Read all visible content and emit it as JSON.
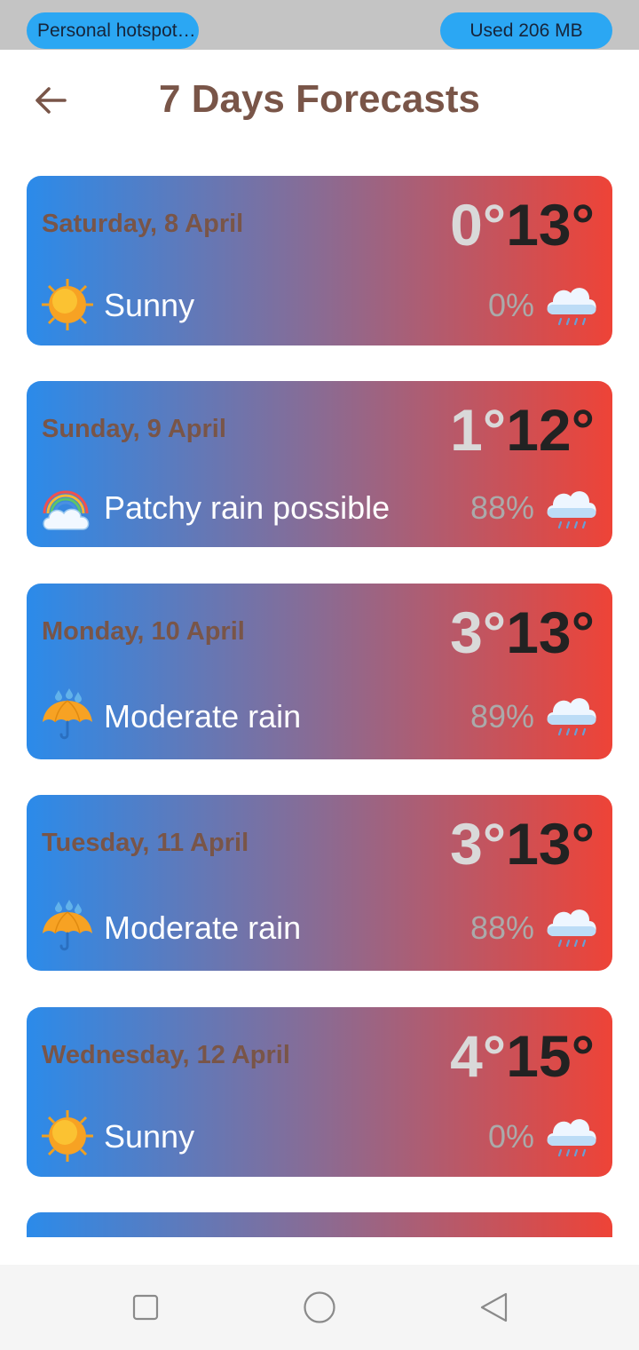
{
  "status": {
    "hotspot_label": "Personal hotspot…",
    "data_usage": "Used  206 MB"
  },
  "header": {
    "back_icon": "arrow-left-icon",
    "title": "7 Days Forecasts"
  },
  "colors": {
    "title": "#795548",
    "card_gradient": [
      "#2b8bea",
      "#8a6b93",
      "#ee4337"
    ],
    "status_pill": "#2ba7f3"
  },
  "forecasts": [
    {
      "date": "Saturday, 8 April",
      "min": "0°",
      "max": "13°",
      "condition": "Sunny",
      "condition_icon": "sun-icon",
      "rain_chance": "0%",
      "rain_icon": "rain-cloud-icon"
    },
    {
      "date": "Sunday, 9 April",
      "min": "1°",
      "max": "12°",
      "condition": "Patchy rain possible",
      "condition_icon": "rainbow-cloud-icon",
      "rain_chance": "88%",
      "rain_icon": "rain-cloud-icon"
    },
    {
      "date": "Monday, 10 April",
      "min": "3°",
      "max": "13°",
      "condition": "Moderate rain",
      "condition_icon": "umbrella-rain-icon",
      "rain_chance": "89%",
      "rain_icon": "rain-cloud-icon"
    },
    {
      "date": "Tuesday, 11 April",
      "min": "3°",
      "max": "13°",
      "condition": "Moderate rain",
      "condition_icon": "umbrella-rain-icon",
      "rain_chance": "88%",
      "rain_icon": "rain-cloud-icon"
    },
    {
      "date": "Wednesday, 12 April",
      "min": "4°",
      "max": "15°",
      "condition": "Sunny",
      "condition_icon": "sun-icon",
      "rain_chance": "0%",
      "rain_icon": "rain-cloud-icon"
    }
  ],
  "navigation": {
    "recents_icon": "square-icon",
    "home_icon": "circle-icon",
    "back_icon": "triangle-back-icon"
  }
}
